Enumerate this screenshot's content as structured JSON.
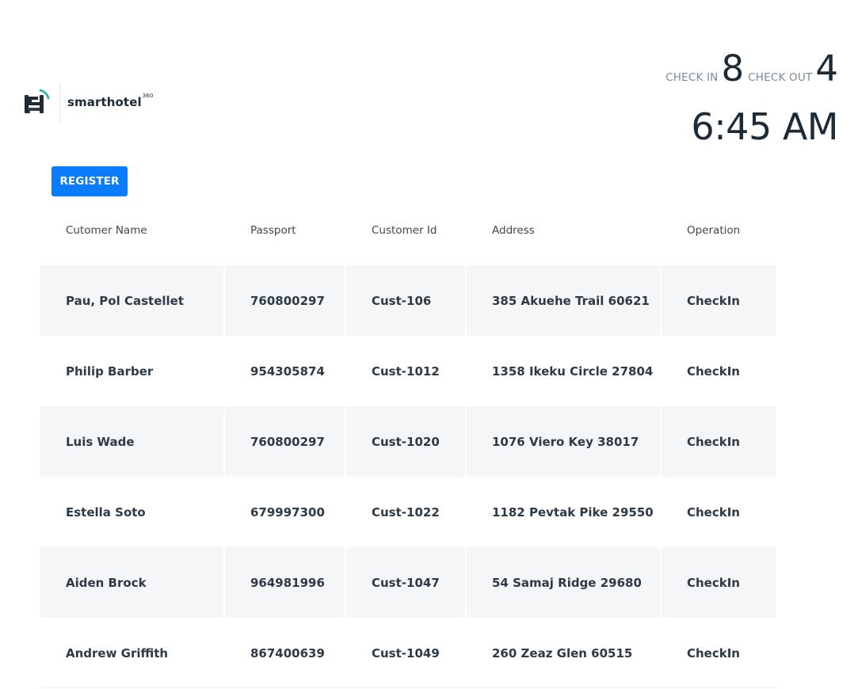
{
  "brand": {
    "name": "smarthotel",
    "superscript": "360"
  },
  "stats": {
    "checkin_label": "CHECK IN",
    "checkin_count": "8",
    "checkout_label": "CHECK OUT",
    "checkout_count": "4"
  },
  "clock": {
    "time": "6:45 AM"
  },
  "actions": {
    "register_label": "REGISTER"
  },
  "table": {
    "headers": [
      "Cutomer Name",
      "Passport",
      "Customer Id",
      "Address",
      "Operation"
    ],
    "rows": [
      {
        "name": "Pau, Pol Castellet",
        "passport": "760800297",
        "customer_id": "Cust-106",
        "address": "385 Akuehe Trail 60621",
        "operation": "CheckIn"
      },
      {
        "name": "Philip Barber",
        "passport": "954305874",
        "customer_id": "Cust-1012",
        "address": "1358 Ikeku Circle 27804",
        "operation": "CheckIn"
      },
      {
        "name": "Luis Wade",
        "passport": "760800297",
        "customer_id": "Cust-1020",
        "address": "1076 Viero Key 38017",
        "operation": "CheckIn"
      },
      {
        "name": "Estella Soto",
        "passport": "679997300",
        "customer_id": "Cust-1022",
        "address": "1182 Pevtak Pike 29550",
        "operation": "CheckIn"
      },
      {
        "name": "Aiden Brock",
        "passport": "964981996",
        "customer_id": "Cust-1047",
        "address": "54 Samaj Ridge 29680",
        "operation": "CheckIn"
      },
      {
        "name": "Andrew Griffith",
        "passport": "867400639",
        "customer_id": "Cust-1049",
        "address": "260 Zeaz Glen 60515",
        "operation": "CheckIn"
      }
    ]
  },
  "colors": {
    "primary": "#0a7cff",
    "text_dark": "#1d2b36",
    "row_alt": "#f5f6f8",
    "logo_accent": "#2aa9b8"
  }
}
